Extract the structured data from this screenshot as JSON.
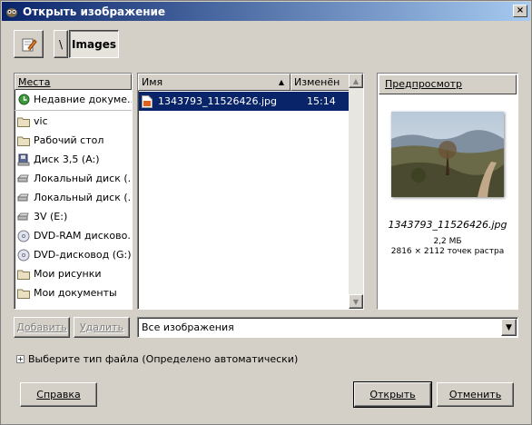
{
  "window": {
    "title": "Открыть изображение",
    "close_label": "×"
  },
  "toolbar": {
    "path_separator": "\\",
    "current_folder": "Images"
  },
  "places": {
    "header": "Места",
    "items": [
      {
        "label": "Недавние докуме...",
        "icon": "recent-icon"
      },
      {
        "label": "vic",
        "icon": "folder-icon"
      },
      {
        "label": "Рабочий стол",
        "icon": "folder-icon"
      },
      {
        "label": "Диск 3,5 (A:)",
        "icon": "floppy-icon"
      },
      {
        "label": "Локальный диск (...",
        "icon": "drive-icon"
      },
      {
        "label": "Локальный диск (...",
        "icon": "drive-icon"
      },
      {
        "label": "3V (E:)",
        "icon": "drive-icon"
      },
      {
        "label": "DVD-RAM дисково...",
        "icon": "dvd-icon"
      },
      {
        "label": "DVD-дисковод (G:)",
        "icon": "dvd-icon"
      },
      {
        "label": "Мои рисунки",
        "icon": "folder-icon"
      },
      {
        "label": "Мои документы",
        "icon": "folder-icon"
      }
    ]
  },
  "files": {
    "columns": {
      "name": "Имя",
      "modified": "Изменён"
    },
    "rows": [
      {
        "name": "1343793_11526426.jpg",
        "modified": "15:14",
        "selected": true
      }
    ]
  },
  "preview": {
    "header": "Предпросмотр",
    "filename": "1343793_11526426.jpg",
    "size": "2,2 МБ",
    "dimensions": "2816 × 2112 точек растра"
  },
  "buttons": {
    "add": "Добавить",
    "remove": "Удалить",
    "help": "Справка",
    "open": "Открыть",
    "cancel": "Отменить"
  },
  "filter": {
    "selected": "Все изображения"
  },
  "file_type": {
    "label": "Выберите тип файла (Определено автоматически)"
  },
  "colors": {
    "selection": "#0a246a",
    "face": "#d4d0c8"
  }
}
